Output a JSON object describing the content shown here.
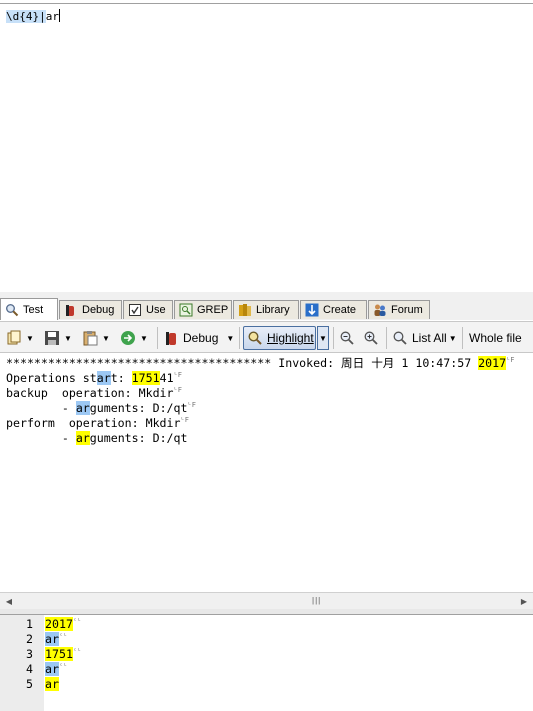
{
  "regex": {
    "part1": "\\d{4}",
    "sep": "|",
    "part2": "ar"
  },
  "tabs": [
    {
      "label": "Test",
      "icon": "magnifier-icon",
      "active": true
    },
    {
      "label": "Debug",
      "icon": "bug-icon"
    },
    {
      "label": "Use",
      "icon": "check-icon"
    },
    {
      "label": "GREP",
      "icon": "grep-icon"
    },
    {
      "label": "Library",
      "icon": "library-icon"
    },
    {
      "label": "Create",
      "icon": "create-icon"
    },
    {
      "label": "Forum",
      "icon": "forum-icon"
    }
  ],
  "toolbar": {
    "debug_label": "Debug",
    "highlight_label": "Highlight",
    "list_all_label": "List All",
    "whole_file_label": "Whole file"
  },
  "test": {
    "stars": "**************************************",
    "invoked": " Invoked: 周日 十月 1 10:47:57 ",
    "year": "2017",
    "line2_a": "Operations st",
    "line2_ar": "ar",
    "line2_b": "t: ",
    "line2_num": "1751",
    "line2_c": "41",
    "line3": "backup  operation: Mkdir",
    "line4_a": "        - ",
    "line4_ar": "ar",
    "line4_b": "guments: D:/qt",
    "line5": "perform  operation: Mkdir",
    "line6_a": "        - ",
    "line6_ar": "ar",
    "line6_b": "guments: D:/qt"
  },
  "results": [
    {
      "num": "1",
      "value": "2017",
      "color": "#ffff00"
    },
    {
      "num": "2",
      "value": "ar",
      "color": "#9cc8f4"
    },
    {
      "num": "3",
      "value": "1751",
      "color": "#ffff00"
    },
    {
      "num": "4",
      "value": "ar",
      "color": "#9cc8f4"
    },
    {
      "num": "5",
      "value": "ar",
      "color": "#ffff00"
    }
  ],
  "colors": {
    "match_blue": "#9cc8f4",
    "match_yellow": "#ffff00"
  }
}
